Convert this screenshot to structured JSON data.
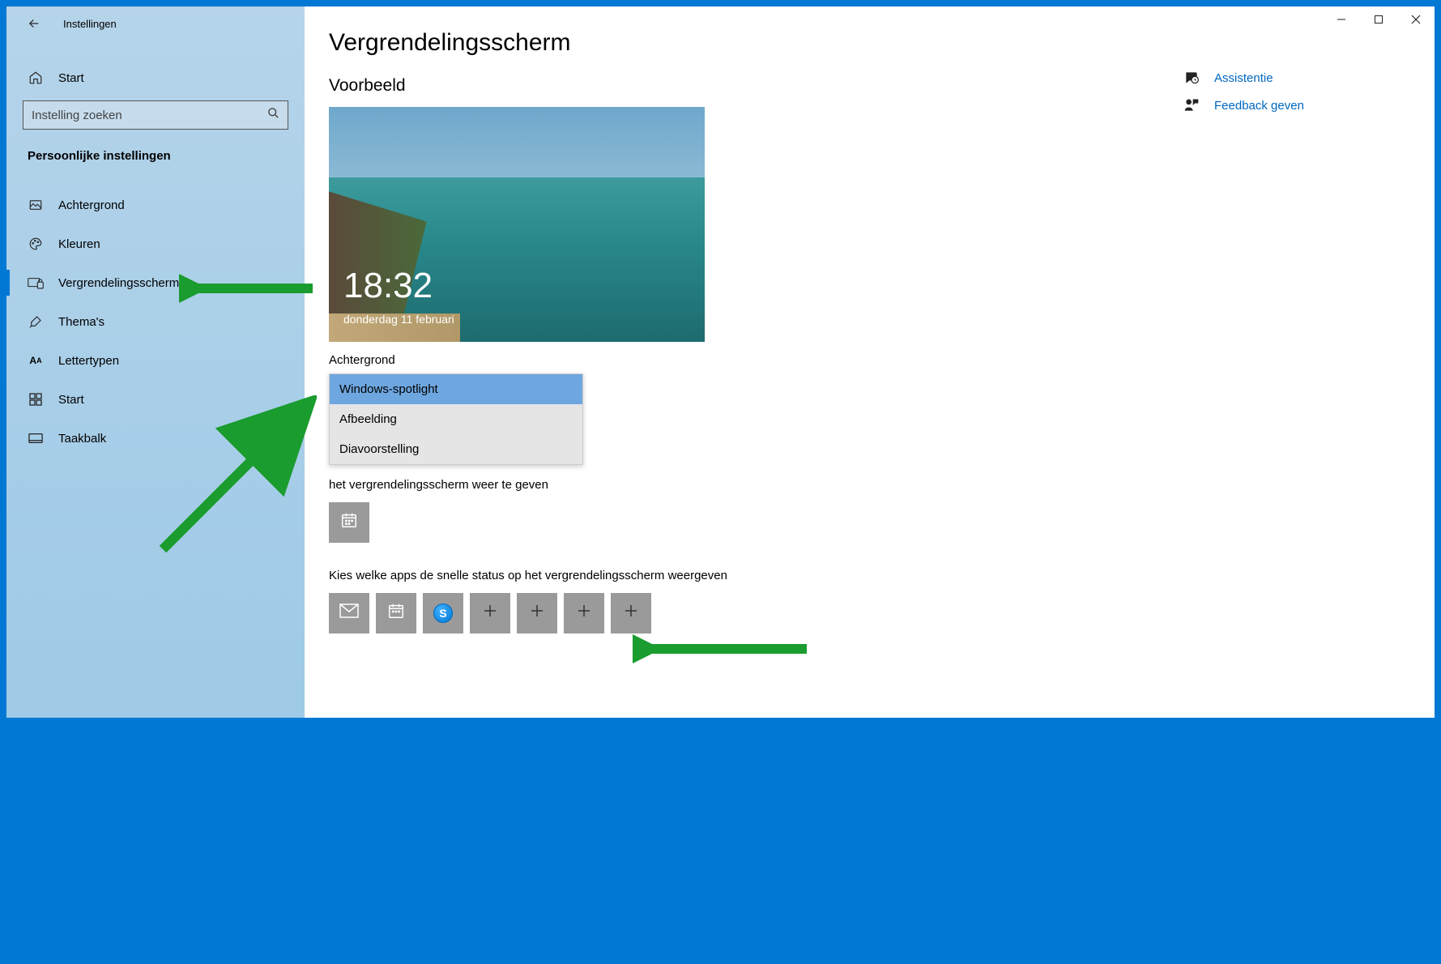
{
  "app_title": "Instellingen",
  "home_label": "Start",
  "search_placeholder": "Instelling zoeken",
  "category_heading": "Persoonlijke instellingen",
  "nav": {
    "items": [
      {
        "id": "achtergrond",
        "label": "Achtergrond",
        "icon": "image-icon"
      },
      {
        "id": "kleuren",
        "label": "Kleuren",
        "icon": "palette-icon"
      },
      {
        "id": "vergrendelingsscherm",
        "label": "Vergrendelingsscherm",
        "icon": "lock-monitor-icon"
      },
      {
        "id": "themas",
        "label": "Thema's",
        "icon": "brush-icon"
      },
      {
        "id": "lettertypen",
        "label": "Lettertypen",
        "icon": "font-icon"
      },
      {
        "id": "start",
        "label": "Start",
        "icon": "start-menu-icon"
      },
      {
        "id": "taakbalk",
        "label": "Taakbalk",
        "icon": "taskbar-icon"
      }
    ],
    "active_id": "vergrendelingsscherm"
  },
  "page": {
    "title": "Vergrendelingsscherm",
    "preview_heading": "Voorbeeld",
    "preview_time": "18:32",
    "preview_date": "donderdag 11 februari",
    "background_label": "Achtergrond",
    "background_options": [
      {
        "value": "spotlight",
        "label": "Windows-spotlight"
      },
      {
        "value": "picture",
        "label": "Afbeelding"
      },
      {
        "value": "slideshow",
        "label": "Diavoorstelling"
      }
    ],
    "background_selected": "spotlight",
    "detailed_status_text_tail": "het vergrendelingsscherm weer te geven",
    "detailed_tile_icon": "calendar-icon",
    "quick_status_text": "Kies welke apps de snelle status op het vergrendelingsscherm weergeven",
    "quick_tiles": [
      {
        "icon": "mail-icon"
      },
      {
        "icon": "calendar-icon"
      },
      {
        "icon": "skype-icon"
      },
      {
        "icon": "plus-icon"
      },
      {
        "icon": "plus-icon"
      },
      {
        "icon": "plus-icon"
      },
      {
        "icon": "plus-icon"
      }
    ]
  },
  "right_panel": {
    "assist_label": "Assistentie",
    "feedback_label": "Feedback geven"
  }
}
